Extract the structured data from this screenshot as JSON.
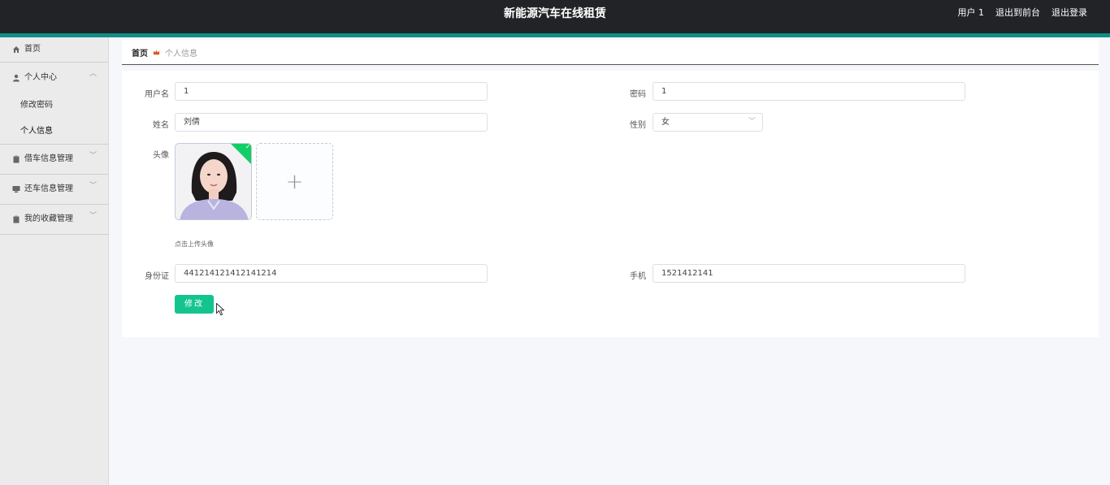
{
  "header": {
    "title": "新能源汽车在线租赁",
    "user_label": "用户 1",
    "to_front_label": "退出到前台",
    "logout_label": "退出登录"
  },
  "sidebar": {
    "items": [
      {
        "label": "首页",
        "icon": "home-icon"
      },
      {
        "label": "个人中心",
        "icon": "user-icon",
        "expanded": true,
        "children": [
          {
            "label": "修改密码"
          },
          {
            "label": "个人信息"
          }
        ]
      },
      {
        "label": "借车信息管理",
        "icon": "clipboard-icon"
      },
      {
        "label": "还车信息管理",
        "icon": "monitor-icon"
      },
      {
        "label": "我的收藏管理",
        "icon": "clipboard-icon"
      }
    ]
  },
  "breadcrumb": {
    "home": "首页",
    "current": "个人信息"
  },
  "form": {
    "username": {
      "label": "用户名",
      "value": "1"
    },
    "password": {
      "label": "密码",
      "value": "1"
    },
    "name": {
      "label": "姓名",
      "value": "刘倩"
    },
    "gender": {
      "label": "性别",
      "value": "女"
    },
    "avatar": {
      "label": "头像",
      "hint": "点击上传头像"
    },
    "idcard": {
      "label": "身份证",
      "value": "441214121412141214"
    },
    "phone": {
      "label": "手机",
      "value": "1521412141"
    },
    "submit_label": "修改"
  },
  "colors": {
    "header_bg": "#222326",
    "accent": "#0f8f86",
    "primary_button": "#13c48f",
    "success_badge": "#13ce66"
  }
}
